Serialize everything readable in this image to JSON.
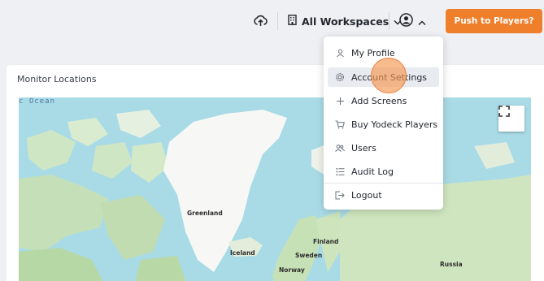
{
  "header": {
    "upload_icon": "cloud-upload-icon",
    "workspace_label": "All Workspaces",
    "workspace_icon": "building-icon",
    "account_icon": "user-circle-icon",
    "push_label": "Push to Players?",
    "push_color": "#ef7f2b"
  },
  "monitor": {
    "title": "Monitor Locations",
    "map": {
      "ocean_label": "c Ocean",
      "labels": [
        "Greenland",
        "Iceland",
        "Finland",
        "Sweden",
        "Norway",
        "Russia"
      ]
    }
  },
  "account_menu": {
    "items": [
      {
        "label": "My Profile",
        "icon": "user-icon"
      },
      {
        "label": "Account Settings",
        "icon": "gear-icon",
        "active": true
      },
      {
        "label": "Add Screens",
        "icon": "plus-icon"
      },
      {
        "label": "Buy Yodeck Players",
        "icon": "cart-icon"
      },
      {
        "label": "Users",
        "icon": "users-icon"
      },
      {
        "label": "Audit Log",
        "icon": "list-icon"
      },
      {
        "label": "Logout",
        "icon": "logout-icon"
      }
    ]
  }
}
